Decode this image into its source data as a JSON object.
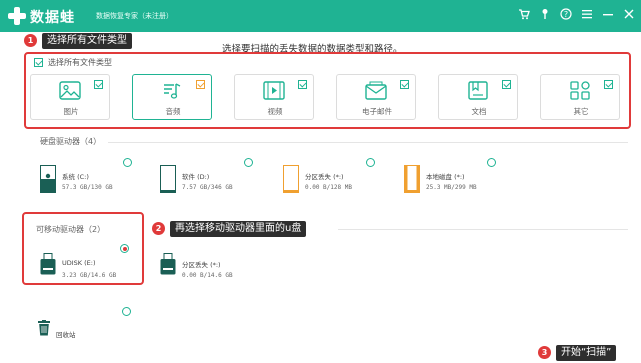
{
  "app": {
    "name": "数据蛙",
    "subtitle": "数据恢复专家（未注册）"
  },
  "titlebar_icons": [
    "cart-icon",
    "key-icon",
    "help-icon",
    "menu-icon",
    "minimize-icon",
    "close-icon"
  ],
  "instruction": "选择要扫描的丢失数据的数据类型和路径。",
  "annotations": {
    "step1": {
      "num": "1",
      "text": "选择所有文件类型"
    },
    "step2": {
      "num": "2",
      "text": "再选择移动驱动器里面的u盘"
    },
    "step3": {
      "num": "3",
      "text": "开始“扫描”"
    }
  },
  "file_types": {
    "select_all_label": "选择所有文件类型",
    "items": [
      {
        "label": "图片",
        "icon": "image-icon"
      },
      {
        "label": "音频",
        "icon": "audio-icon",
        "selected": true
      },
      {
        "label": "视频",
        "icon": "video-icon"
      },
      {
        "label": "电子邮件",
        "icon": "email-icon"
      },
      {
        "label": "文档",
        "icon": "document-icon"
      },
      {
        "label": "其它",
        "icon": "other-icon"
      }
    ]
  },
  "hard_drives": {
    "title": "硬盘驱动器（4）",
    "items": [
      {
        "name": "系统 (C:)",
        "size": "57.3 GB/130 GB"
      },
      {
        "name": "软件 (D:)",
        "size": "7.57 GB/346 GB"
      },
      {
        "name": "分区丢失 (*:)",
        "size": "0.00 B/128 MB"
      },
      {
        "name": "本地磁盘 (*:)",
        "size": "25.3 MB/299 MB"
      }
    ]
  },
  "removable_drives": {
    "title": "可移动驱动器（2）",
    "items": [
      {
        "name": "UDISK (E:)",
        "size": "3.23 GB/14.6 GB",
        "selected": true
      },
      {
        "name": "分区丢失 (*:)",
        "size": "0.00  B/14.6 GB"
      }
    ]
  },
  "recycle_bin": {
    "label": "回收站"
  },
  "colors": {
    "accent": "#1fb393",
    "annotation_red": "#e03a3a",
    "annotation_bg": "#2e2e2e",
    "orange": "#f0a030"
  }
}
